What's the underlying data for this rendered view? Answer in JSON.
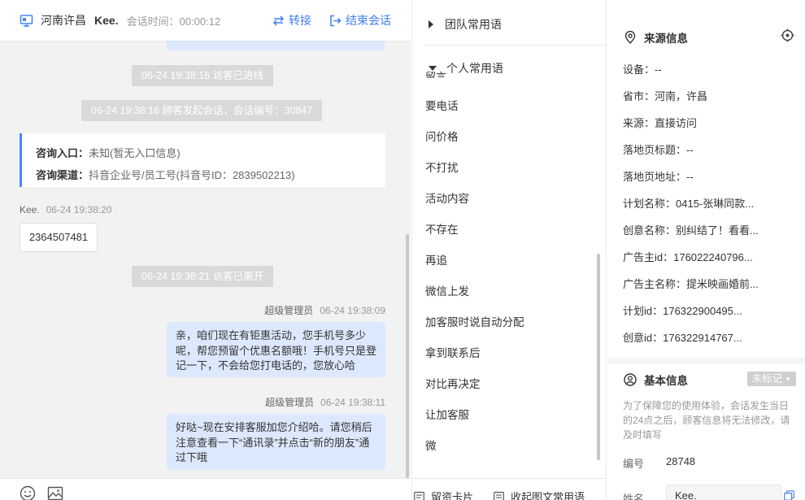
{
  "chat": {
    "header": {
      "location": "河南许昌",
      "visitor_name": "Kee.",
      "session_time_label": "会话时间：",
      "session_time": "00:00:12",
      "transfer_label": "转接",
      "end_label": "结束会话"
    },
    "system_messages": {
      "visitor_entered": "06-24 19:38:16 访客已进线",
      "session_started": "06-24 19:38:16 顾客发起会话，会话编号：30847",
      "visitor_left": "06-24 19:38:21 访客已离开"
    },
    "consult_card": {
      "entry_label": "咨询入口：",
      "entry_value": "未知(暂无入口信息)",
      "channel_label": "咨询渠道：",
      "channel_value": "抖音企业号/员工号(抖音号ID：2839502213)"
    },
    "visitor_message": {
      "sender": "Kee.",
      "time": "06-24 19:38:20",
      "text": "2364507481"
    },
    "agent_messages": [
      {
        "sender": "超级管理员",
        "time": "06-24 19:38:09",
        "text": "亲，咱们现在有钜惠活动，您手机号多少呢，帮您预留个优惠名额哦！手机号只是登记一下，不会给您打电话的，您放心哈"
      },
      {
        "sender": "超级管理员",
        "time": "06-24 19:38:11",
        "text": "好哒~现在安排客服加您介绍哈。请您稍后注意查看一下“通讯录”并点击“新的朋友”通过下哦"
      }
    ],
    "footer": {
      "emoji_icon": "smile-icon",
      "image_icon": "image-icon"
    }
  },
  "phrases": {
    "team_group": "团队常用语",
    "personal_group": "个人常用语",
    "items": [
      "要电话",
      "问价格",
      "不打扰",
      "活动内容",
      "不存在",
      "再追",
      "微信上发",
      "加客服时说自动分配",
      "拿到联系后",
      "对比再决定",
      "让加客服",
      "微"
    ],
    "footer": {
      "card_label": "留资卡片",
      "collapse_label": "收起图文常用语"
    }
  },
  "info": {
    "source_title": "来源信息",
    "source_rows": [
      "设备：--",
      "省市：河南，许昌",
      "来源：直接访问",
      "落地页标题：--",
      "落地页地址：--",
      "计划名称：0415-张琳同款...",
      "创意名称：别纠结了！看看...",
      "广告主id：176022240796...",
      "广告主名称：提米映画婚前...",
      "计划id：176322900495...",
      "创意id：176322914767..."
    ],
    "basic_title": "基本信息",
    "mark_tag": "未标记",
    "notice": "为了保障您的使用体验，会话发生当日的24点之后，顾客信息将无法修改，请及时填写",
    "id_label": "编号",
    "id_value": "28748",
    "name_label": "姓名",
    "name_value": "Kee."
  },
  "colors": {
    "accent": "#3f7ef5",
    "bubble": "#dce8fd",
    "chat_bg": "#f2f2f2",
    "system_tag": "#d9d9d9"
  }
}
